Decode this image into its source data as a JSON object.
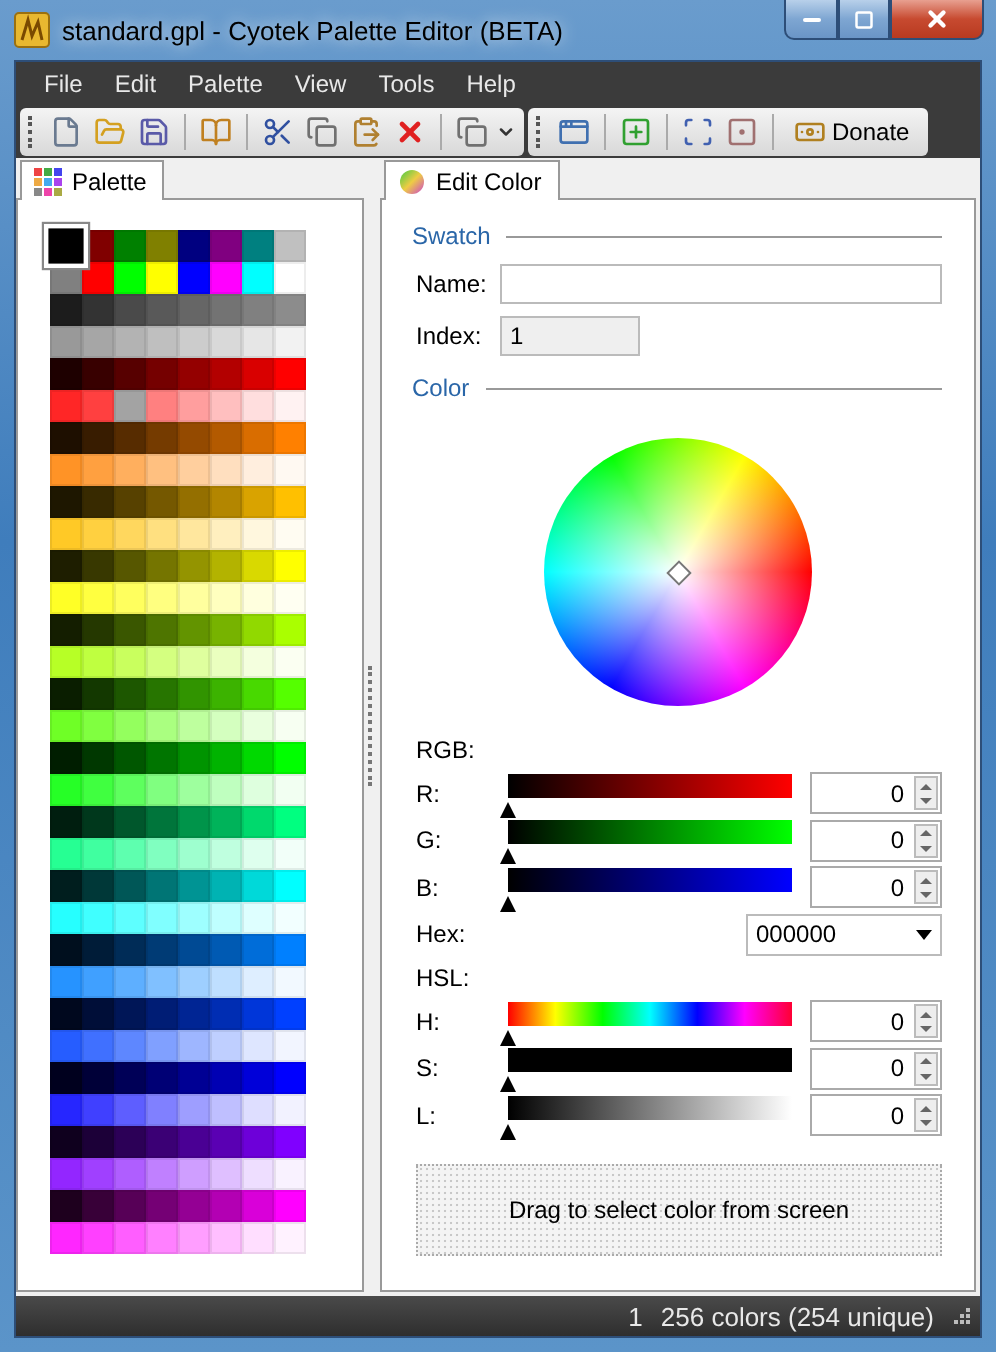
{
  "window": {
    "title": "standard.gpl - Cyotek Palette Editor (BETA)"
  },
  "menu": [
    {
      "label": "File"
    },
    {
      "label": "Edit"
    },
    {
      "label": "Palette"
    },
    {
      "label": "View"
    },
    {
      "label": "Tools"
    },
    {
      "label": "Help"
    }
  ],
  "toolbar": {
    "donate_label": "Donate"
  },
  "palette": {
    "tabs": [
      {
        "label": "Palette",
        "selected": true
      }
    ],
    "swatches": [
      {
        "color": "#000000",
        "selected": true
      },
      {
        "color": "#800000",
        "selected": false
      },
      {
        "color": "#008000",
        "selected": false
      },
      {
        "color": "#808000",
        "selected": false
      },
      {
        "color": "#000080",
        "selected": false
      },
      {
        "color": "#800080",
        "selected": false
      },
      {
        "color": "#008080",
        "selected": false
      },
      {
        "color": "#c0c0c0",
        "selected": false
      },
      {
        "color": "#808080",
        "selected": false
      },
      {
        "color": "#ff0000",
        "selected": false
      },
      {
        "color": "#00ff00",
        "selected": false
      },
      {
        "color": "#ffff00",
        "selected": false
      },
      {
        "color": "#0000ff",
        "selected": false
      },
      {
        "color": "#ff00ff",
        "selected": false
      },
      {
        "color": "#00ffff",
        "selected": false
      },
      {
        "color": "#ffffff",
        "selected": false
      },
      {
        "color": "#1c1c1c",
        "selected": false
      },
      {
        "color": "#333333",
        "selected": false
      },
      {
        "color": "#4a4a4a",
        "selected": false
      },
      {
        "color": "#595959",
        "selected": false
      },
      {
        "color": "#666666",
        "selected": false
      },
      {
        "color": "#737373",
        "selected": false
      },
      {
        "color": "#808080",
        "selected": false
      },
      {
        "color": "#8c8c8c",
        "selected": false
      },
      {
        "color": "#999999",
        "selected": false
      },
      {
        "color": "#a6a6a6",
        "selected": false
      },
      {
        "color": "#b3b3b3",
        "selected": false
      },
      {
        "color": "#bfbfbf",
        "selected": false
      },
      {
        "color": "#cccccc",
        "selected": false
      },
      {
        "color": "#d9d9d9",
        "selected": false
      },
      {
        "color": "#e6e6e6",
        "selected": false
      },
      {
        "color": "#f2f2f2",
        "selected": false
      },
      {
        "color": "#1e0000",
        "selected": false
      },
      {
        "color": "#380000",
        "selected": false
      },
      {
        "color": "#570000",
        "selected": false
      },
      {
        "color": "#750000",
        "selected": false
      },
      {
        "color": "#940000",
        "selected": false
      },
      {
        "color": "#b30000",
        "selected": false
      },
      {
        "color": "#d90000",
        "selected": false
      },
      {
        "color": "#ff0000",
        "selected": false
      },
      {
        "color": "#ff2626",
        "selected": false
      },
      {
        "color": "#ff4040",
        "selected": false
      },
      {
        "color": "#a3a3a3",
        "selected": false
      },
      {
        "color": "#ff8080",
        "selected": false
      },
      {
        "color": "#ff9e9e",
        "selected": false
      },
      {
        "color": "#ffbfbf",
        "selected": false
      },
      {
        "color": "#ffdede",
        "selected": false
      },
      {
        "color": "#fff2f2",
        "selected": false
      },
      {
        "color": "#1e0f00",
        "selected": false
      },
      {
        "color": "#381c00",
        "selected": false
      },
      {
        "color": "#572c00",
        "selected": false
      },
      {
        "color": "#753b00",
        "selected": false
      },
      {
        "color": "#944a00",
        "selected": false
      },
      {
        "color": "#b35a00",
        "selected": false
      },
      {
        "color": "#d96d00",
        "selected": false
      },
      {
        "color": "#ff8000",
        "selected": false
      },
      {
        "color": "#ff9326",
        "selected": false
      },
      {
        "color": "#ffa040",
        "selected": false
      },
      {
        "color": "#ffaf5e",
        "selected": false
      },
      {
        "color": "#ffc080",
        "selected": false
      },
      {
        "color": "#ffcf9e",
        "selected": false
      },
      {
        "color": "#ffdfbf",
        "selected": false
      },
      {
        "color": "#ffeede",
        "selected": false
      },
      {
        "color": "#fff9f2",
        "selected": false
      },
      {
        "color": "#1e1700",
        "selected": false
      },
      {
        "color": "#382a00",
        "selected": false
      },
      {
        "color": "#574100",
        "selected": false
      },
      {
        "color": "#755800",
        "selected": false
      },
      {
        "color": "#946f00",
        "selected": false
      },
      {
        "color": "#b38600",
        "selected": false
      },
      {
        "color": "#d9a300",
        "selected": false
      },
      {
        "color": "#ffc000",
        "selected": false
      },
      {
        "color": "#ffc926",
        "selected": false
      },
      {
        "color": "#ffd040",
        "selected": false
      },
      {
        "color": "#ffd75e",
        "selected": false
      },
      {
        "color": "#ffe080",
        "selected": false
      },
      {
        "color": "#ffe79e",
        "selected": false
      },
      {
        "color": "#ffefbf",
        "selected": false
      },
      {
        "color": "#fff7de",
        "selected": false
      },
      {
        "color": "#fffcf2",
        "selected": false
      },
      {
        "color": "#1e1e00",
        "selected": false
      },
      {
        "color": "#383800",
        "selected": false
      },
      {
        "color": "#575700",
        "selected": false
      },
      {
        "color": "#757500",
        "selected": false
      },
      {
        "color": "#949400",
        "selected": false
      },
      {
        "color": "#b3b300",
        "selected": false
      },
      {
        "color": "#d9d900",
        "selected": false
      },
      {
        "color": "#ffff00",
        "selected": false
      },
      {
        "color": "#ffff26",
        "selected": false
      },
      {
        "color": "#ffff40",
        "selected": false
      },
      {
        "color": "#ffff5e",
        "selected": false
      },
      {
        "color": "#ffff80",
        "selected": false
      },
      {
        "color": "#ffff9e",
        "selected": false
      },
      {
        "color": "#ffffbf",
        "selected": false
      },
      {
        "color": "#ffffde",
        "selected": false
      },
      {
        "color": "#fffff2",
        "selected": false
      },
      {
        "color": "#141e00",
        "selected": false
      },
      {
        "color": "#253800",
        "selected": false
      },
      {
        "color": "#3a5700",
        "selected": false
      },
      {
        "color": "#4e7500",
        "selected": false
      },
      {
        "color": "#639400",
        "selected": false
      },
      {
        "color": "#77b300",
        "selected": false
      },
      {
        "color": "#91d900",
        "selected": false
      },
      {
        "color": "#aaff00",
        "selected": false
      },
      {
        "color": "#b7ff26",
        "selected": false
      },
      {
        "color": "#bfff40",
        "selected": false
      },
      {
        "color": "#c9ff5e",
        "selected": false
      },
      {
        "color": "#d4ff80",
        "selected": false
      },
      {
        "color": "#dfff9e",
        "selected": false
      },
      {
        "color": "#eaffbf",
        "selected": false
      },
      {
        "color": "#f4ffde",
        "selected": false
      },
      {
        "color": "#fbfff2",
        "selected": false
      },
      {
        "color": "#0a1e00",
        "selected": false
      },
      {
        "color": "#133800",
        "selected": false
      },
      {
        "color": "#1d5700",
        "selected": false
      },
      {
        "color": "#277500",
        "selected": false
      },
      {
        "color": "#319400",
        "selected": false
      },
      {
        "color": "#3cb300",
        "selected": false
      },
      {
        "color": "#48d900",
        "selected": false
      },
      {
        "color": "#55ff00",
        "selected": false
      },
      {
        "color": "#6fff26",
        "selected": false
      },
      {
        "color": "#80ff40",
        "selected": false
      },
      {
        "color": "#94ff5e",
        "selected": false
      },
      {
        "color": "#aaff80",
        "selected": false
      },
      {
        "color": "#beff9e",
        "selected": false
      },
      {
        "color": "#d4ffbf",
        "selected": false
      },
      {
        "color": "#e9ffde",
        "selected": false
      },
      {
        "color": "#f7fff2",
        "selected": false
      },
      {
        "color": "#001e00",
        "selected": false
      },
      {
        "color": "#003800",
        "selected": false
      },
      {
        "color": "#005700",
        "selected": false
      },
      {
        "color": "#007500",
        "selected": false
      },
      {
        "color": "#009400",
        "selected": false
      },
      {
        "color": "#00b300",
        "selected": false
      },
      {
        "color": "#00d900",
        "selected": false
      },
      {
        "color": "#00ff00",
        "selected": false
      },
      {
        "color": "#26ff26",
        "selected": false
      },
      {
        "color": "#40ff40",
        "selected": false
      },
      {
        "color": "#5eff5e",
        "selected": false
      },
      {
        "color": "#80ff80",
        "selected": false
      },
      {
        "color": "#9eff9e",
        "selected": false
      },
      {
        "color": "#bfffbf",
        "selected": false
      },
      {
        "color": "#deffde",
        "selected": false
      },
      {
        "color": "#f2fff2",
        "selected": false
      },
      {
        "color": "#001e0f",
        "selected": false
      },
      {
        "color": "#00381c",
        "selected": false
      },
      {
        "color": "#00572c",
        "selected": false
      },
      {
        "color": "#00753b",
        "selected": false
      },
      {
        "color": "#00944a",
        "selected": false
      },
      {
        "color": "#00b35a",
        "selected": false
      },
      {
        "color": "#00d96d",
        "selected": false
      },
      {
        "color": "#00ff80",
        "selected": false
      },
      {
        "color": "#26ff93",
        "selected": false
      },
      {
        "color": "#40ffa0",
        "selected": false
      },
      {
        "color": "#5effaf",
        "selected": false
      },
      {
        "color": "#80ffc0",
        "selected": false
      },
      {
        "color": "#9effcf",
        "selected": false
      },
      {
        "color": "#bfffdf",
        "selected": false
      },
      {
        "color": "#deffee",
        "selected": false
      },
      {
        "color": "#f2fff9",
        "selected": false
      },
      {
        "color": "#001e1e",
        "selected": false
      },
      {
        "color": "#003838",
        "selected": false
      },
      {
        "color": "#005757",
        "selected": false
      },
      {
        "color": "#007575",
        "selected": false
      },
      {
        "color": "#009494",
        "selected": false
      },
      {
        "color": "#00b3b3",
        "selected": false
      },
      {
        "color": "#00d9d9",
        "selected": false
      },
      {
        "color": "#00ffff",
        "selected": false
      },
      {
        "color": "#26ffff",
        "selected": false
      },
      {
        "color": "#40ffff",
        "selected": false
      },
      {
        "color": "#5effff",
        "selected": false
      },
      {
        "color": "#80ffff",
        "selected": false
      },
      {
        "color": "#9effff",
        "selected": false
      },
      {
        "color": "#bfffff",
        "selected": false
      },
      {
        "color": "#deffff",
        "selected": false
      },
      {
        "color": "#f2ffff",
        "selected": false
      },
      {
        "color": "#000f1e",
        "selected": false
      },
      {
        "color": "#001c38",
        "selected": false
      },
      {
        "color": "#002c57",
        "selected": false
      },
      {
        "color": "#003b75",
        "selected": false
      },
      {
        "color": "#004a94",
        "selected": false
      },
      {
        "color": "#005ab3",
        "selected": false
      },
      {
        "color": "#006dd9",
        "selected": false
      },
      {
        "color": "#0080ff",
        "selected": false
      },
      {
        "color": "#2693ff",
        "selected": false
      },
      {
        "color": "#40a0ff",
        "selected": false
      },
      {
        "color": "#5eafff",
        "selected": false
      },
      {
        "color": "#80c0ff",
        "selected": false
      },
      {
        "color": "#9ecfff",
        "selected": false
      },
      {
        "color": "#bfdfff",
        "selected": false
      },
      {
        "color": "#deeeff",
        "selected": false
      },
      {
        "color": "#f2f9ff",
        "selected": false
      },
      {
        "color": "#00081e",
        "selected": false
      },
      {
        "color": "#000e38",
        "selected": false
      },
      {
        "color": "#001657",
        "selected": false
      },
      {
        "color": "#001d75",
        "selected": false
      },
      {
        "color": "#002594",
        "selected": false
      },
      {
        "color": "#002db3",
        "selected": false
      },
      {
        "color": "#0036d9",
        "selected": false
      },
      {
        "color": "#0040ff",
        "selected": false
      },
      {
        "color": "#265dff",
        "selected": false
      },
      {
        "color": "#4070ff",
        "selected": false
      },
      {
        "color": "#5e87ff",
        "selected": false
      },
      {
        "color": "#80a0ff",
        "selected": false
      },
      {
        "color": "#9eb6ff",
        "selected": false
      },
      {
        "color": "#bfcfff",
        "selected": false
      },
      {
        "color": "#dee6ff",
        "selected": false
      },
      {
        "color": "#f2f5ff",
        "selected": false
      },
      {
        "color": "#00001e",
        "selected": false
      },
      {
        "color": "#000038",
        "selected": false
      },
      {
        "color": "#000057",
        "selected": false
      },
      {
        "color": "#000075",
        "selected": false
      },
      {
        "color": "#000094",
        "selected": false
      },
      {
        "color": "#0000b3",
        "selected": false
      },
      {
        "color": "#0000d9",
        "selected": false
      },
      {
        "color": "#0000ff",
        "selected": false
      },
      {
        "color": "#2626ff",
        "selected": false
      },
      {
        "color": "#4040ff",
        "selected": false
      },
      {
        "color": "#5e5eff",
        "selected": false
      },
      {
        "color": "#8080ff",
        "selected": false
      },
      {
        "color": "#9e9eff",
        "selected": false
      },
      {
        "color": "#bfbfff",
        "selected": false
      },
      {
        "color": "#dedeff",
        "selected": false
      },
      {
        "color": "#f2f2ff",
        "selected": false
      },
      {
        "color": "#0f001e",
        "selected": false
      },
      {
        "color": "#1c0038",
        "selected": false
      },
      {
        "color": "#2c0057",
        "selected": false
      },
      {
        "color": "#3b0075",
        "selected": false
      },
      {
        "color": "#4a0094",
        "selected": false
      },
      {
        "color": "#5a00b3",
        "selected": false
      },
      {
        "color": "#6d00d9",
        "selected": false
      },
      {
        "color": "#8000ff",
        "selected": false
      },
      {
        "color": "#9326ff",
        "selected": false
      },
      {
        "color": "#a040ff",
        "selected": false
      },
      {
        "color": "#af5eff",
        "selected": false
      },
      {
        "color": "#c080ff",
        "selected": false
      },
      {
        "color": "#cf9eff",
        "selected": false
      },
      {
        "color": "#dfbfff",
        "selected": false
      },
      {
        "color": "#eedeff",
        "selected": false
      },
      {
        "color": "#f9f2ff",
        "selected": false
      },
      {
        "color": "#1e001e",
        "selected": false
      },
      {
        "color": "#380038",
        "selected": false
      },
      {
        "color": "#570057",
        "selected": false
      },
      {
        "color": "#750075",
        "selected": false
      },
      {
        "color": "#940094",
        "selected": false
      },
      {
        "color": "#b300b3",
        "selected": false
      },
      {
        "color": "#d900d9",
        "selected": false
      },
      {
        "color": "#ff00ff",
        "selected": false
      },
      {
        "color": "#ff26ff",
        "selected": false
      },
      {
        "color": "#ff40ff",
        "selected": false
      },
      {
        "color": "#ff5eff",
        "selected": false
      },
      {
        "color": "#ff80ff",
        "selected": false
      },
      {
        "color": "#ff9eff",
        "selected": false
      },
      {
        "color": "#ffbfff",
        "selected": false
      },
      {
        "color": "#ffdeff",
        "selected": false
      },
      {
        "color": "#fff2ff",
        "selected": false
      }
    ]
  },
  "editor": {
    "tabs": [
      {
        "label": "Edit Color",
        "selected": true
      }
    ],
    "swatch": {
      "heading": "Swatch",
      "name_label": "Name:",
      "index_label": "Index:",
      "index_value": "1"
    },
    "color": {
      "heading": "Color",
      "rgb_label": "RGB:",
      "rgb_channels": [
        {
          "kind": "red",
          "label": "R:",
          "value": "0",
          "level": 0
        },
        {
          "kind": "green",
          "label": "G:",
          "value": "0",
          "level": 0
        },
        {
          "kind": "blue",
          "label": "B:",
          "value": "0",
          "level": 0
        }
      ],
      "hex_label": "Hex:",
      "hex_value": "000000",
      "hsl_label": "HSL:",
      "hsl_channels": [
        {
          "kind": "hue",
          "label": "H:",
          "value": "0",
          "level": 0
        },
        {
          "kind": "saturation",
          "label": "S:",
          "value": "0",
          "level": 0
        },
        {
          "kind": "lightness",
          "label": "L:",
          "value": "0",
          "level": 0
        }
      ],
      "picker_text": "Drag to select color from screen"
    }
  },
  "status_bar": {
    "index": "1",
    "summary": "256 colors (254 unique)"
  }
}
